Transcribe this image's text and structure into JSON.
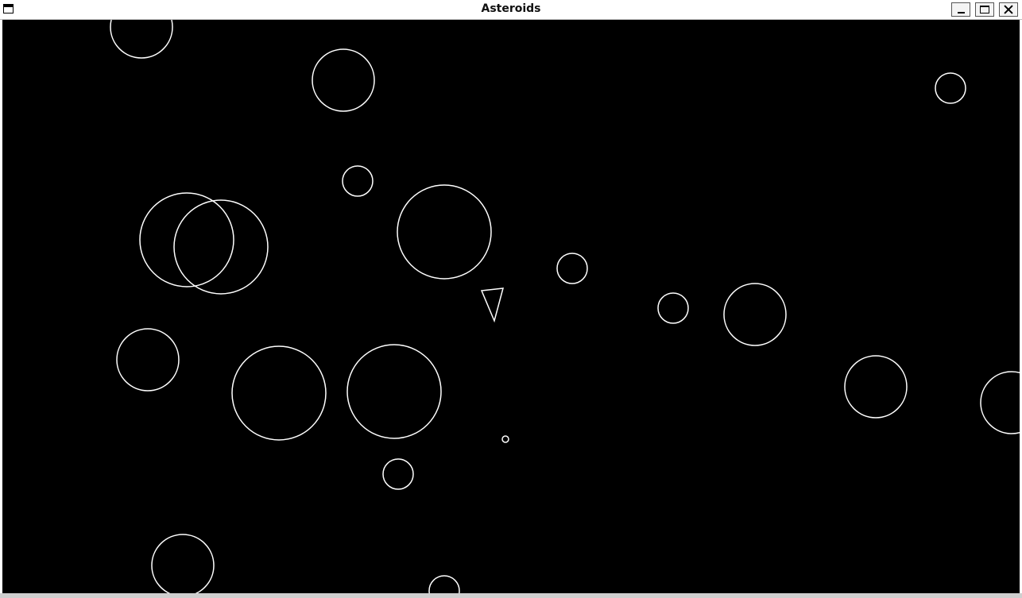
{
  "window": {
    "title": "Asteroids",
    "icon": "window-menu-icon",
    "controls": {
      "minimize": "minimize-icon",
      "maximize": "maximize-icon",
      "close": "close-icon"
    }
  },
  "game": {
    "background": "#000000",
    "stroke": "#ffffff"
  }
}
